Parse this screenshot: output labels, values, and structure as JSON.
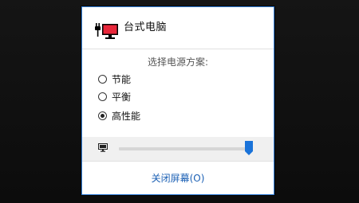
{
  "device": {
    "title": "台式电脑",
    "icon": "desktop-power-icon"
  },
  "power_plan": {
    "caption": "选择电源方案:",
    "options": [
      {
        "label": "节能",
        "selected": false
      },
      {
        "label": "平衡",
        "selected": false
      },
      {
        "label": "高性能",
        "selected": true
      }
    ]
  },
  "brightness": {
    "icon": "monitor-icon",
    "level": 0.98
  },
  "footer": {
    "turn_off_display_label": "关闭屏幕(O)"
  },
  "colors": {
    "accent": "#1a73d9",
    "border": "#2e7bd6",
    "link": "#1a5fb4",
    "screen_red": "#e8273a"
  }
}
